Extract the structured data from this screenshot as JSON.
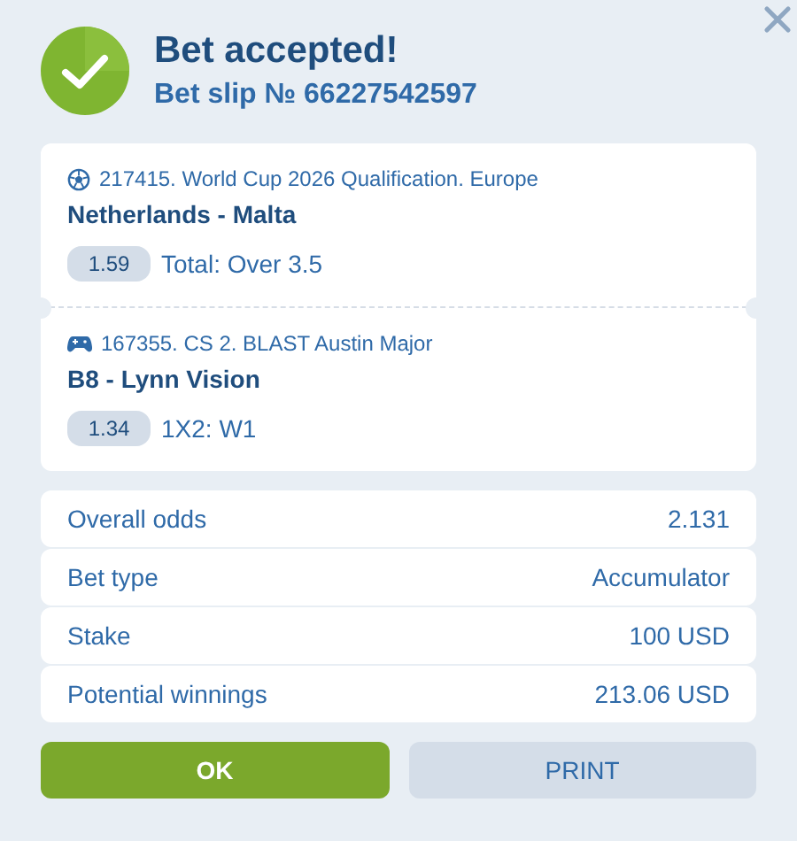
{
  "header": {
    "title": "Bet accepted!",
    "subtitle": "Bet slip № 66227542597"
  },
  "events": [
    {
      "kind": "football",
      "league": "217415. World Cup 2026 Qualification. Europe",
      "match": "Netherlands - Malta",
      "odds": "1.59",
      "market": "Total: Over 3.5"
    },
    {
      "kind": "esports",
      "league": "167355. CS 2. BLAST Austin Major",
      "match": "B8 - Lynn Vision",
      "odds": "1.34",
      "market": "1X2: W1"
    }
  ],
  "summary": [
    {
      "label": "Overall odds",
      "value": "2.131"
    },
    {
      "label": "Bet type",
      "value": "Accumulator"
    },
    {
      "label": "Stake",
      "value": "100 USD"
    },
    {
      "label": "Potential winnings",
      "value": "213.06 USD"
    }
  ],
  "buttons": [
    {
      "label": "OK",
      "kind": "primary"
    },
    {
      "label": "PRINT",
      "kind": "secondary"
    }
  ]
}
